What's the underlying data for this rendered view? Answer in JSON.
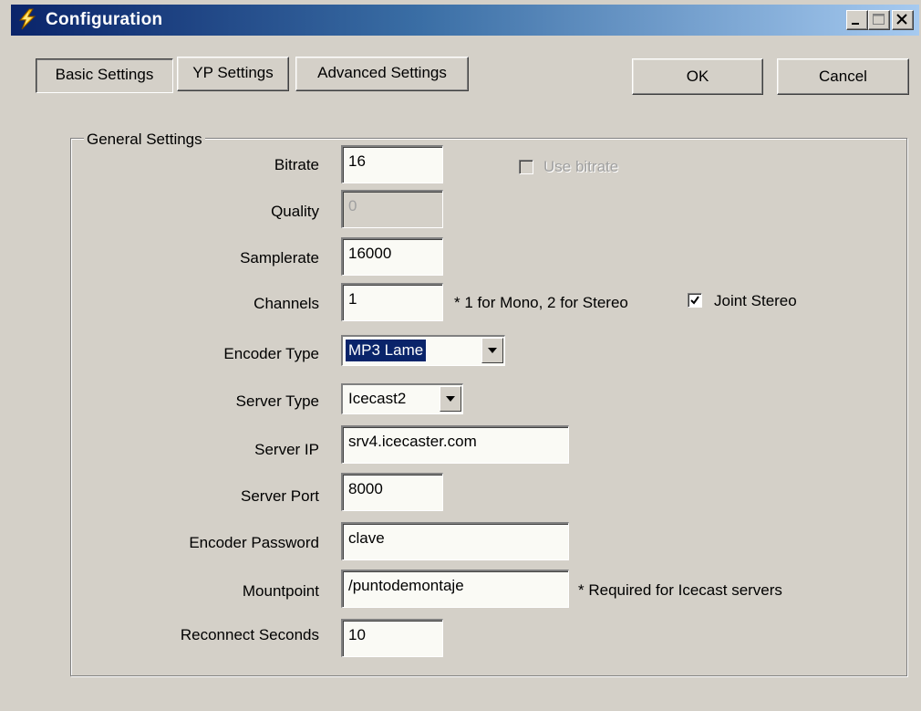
{
  "window": {
    "title": "Configuration",
    "icon": "lightning-icon",
    "controls": [
      "minimize-icon",
      "maximize-icon",
      "close-icon"
    ]
  },
  "tabs": [
    {
      "label": "Basic Settings",
      "active": true
    },
    {
      "label": "YP Settings",
      "active": false
    },
    {
      "label": "Advanced Settings",
      "active": false
    }
  ],
  "buttons": {
    "ok": "OK",
    "cancel": "Cancel"
  },
  "group": {
    "label": "General Settings"
  },
  "fields": {
    "bitrate": {
      "label": "Bitrate",
      "value": "16"
    },
    "quality": {
      "label": "Quality",
      "value": "0",
      "disabled": true
    },
    "samplerate": {
      "label": "Samplerate",
      "value": "16000"
    },
    "channels": {
      "label": "Channels",
      "value": "1",
      "note": "* 1 for Mono, 2 for Stereo"
    },
    "encoder_type": {
      "label": "Encoder Type",
      "value": "MP3 Lame"
    },
    "server_type": {
      "label": "Server Type",
      "value": "Icecast2"
    },
    "server_ip": {
      "label": "Server IP",
      "value": "srv4.icecaster.com"
    },
    "server_port": {
      "label": "Server Port",
      "value": "8000"
    },
    "encoder_password": {
      "label": "Encoder Password",
      "value": "clave"
    },
    "mountpoint": {
      "label": "Mountpoint",
      "value": "/puntodemontaje",
      "note": "* Required for Icecast servers"
    },
    "reconnect_seconds": {
      "label": "Reconnect Seconds",
      "value": "10"
    }
  },
  "checkboxes": {
    "use_bitrate": {
      "label": "Use bitrate",
      "checked": false,
      "disabled": true
    },
    "joint_stereo": {
      "label": "Joint Stereo",
      "checked": true
    }
  },
  "colors": {
    "titlebar_start": "#0a246a",
    "titlebar_end": "#a6caf0",
    "face": "#d4d0c8"
  }
}
